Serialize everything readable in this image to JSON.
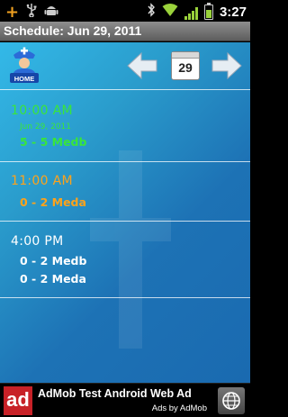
{
  "status_bar": {
    "time": "3:27",
    "icons": [
      "add-notification-icon",
      "usb-icon",
      "android-debug-icon",
      "bluetooth-icon",
      "wifi-icon",
      "signal-icon",
      "battery-icon"
    ]
  },
  "title_bar": {
    "title": "Schedule: Jun 29, 2011"
  },
  "toolbar": {
    "home_label": "HOME",
    "calendar_day": "29",
    "icons": [
      "home-icon",
      "arrow-left-icon",
      "calendar-icon",
      "arrow-right-icon"
    ]
  },
  "schedule": [
    {
      "time": "10:00 AM",
      "date": "Jun 29, 2011",
      "entries": [
        "5 - 5 Medb"
      ],
      "color": "#39e639"
    },
    {
      "time": "11:00 AM",
      "entries": [
        "0 - 2 Meda"
      ],
      "color": "#ffa31a"
    },
    {
      "time": "4:00 PM",
      "entries": [
        "0 - 2 Medb",
        "0 - 2 Meda"
      ],
      "color": "#ffffff"
    }
  ],
  "ad": {
    "logo_text": "ad",
    "title": "AdMob Test Android Web Ad",
    "by": "Ads by AdMob"
  },
  "colors": {
    "accent_green": "#39e639",
    "accent_orange": "#ffa31a",
    "background_gradient_start": "#33b9e8",
    "background_gradient_end": "#1a6ab0"
  }
}
